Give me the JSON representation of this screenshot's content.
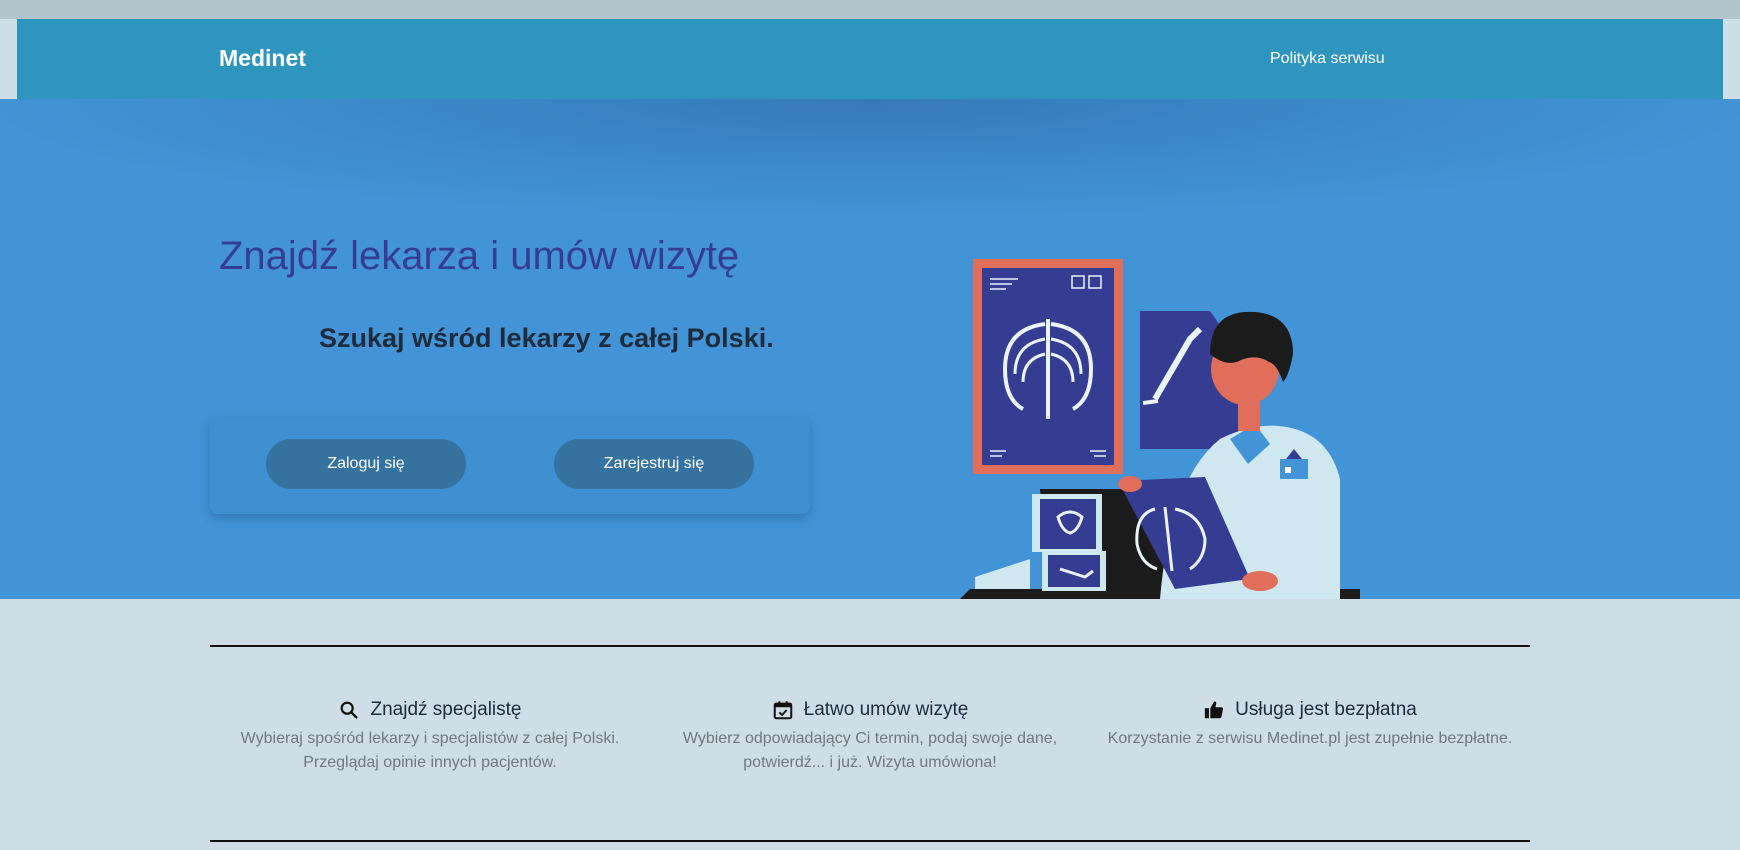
{
  "header": {
    "brand": "Medinet",
    "nav_link": "Polityka serwisu"
  },
  "hero": {
    "title": "Znajdź lekarza i umów wizytę",
    "subtitle": "Szukaj wśród lekarzy z całej Polski.",
    "login_button": "Zaloguj się",
    "register_button": "Zarejestruj się",
    "illustration_icon": "doctor-xray-illustration"
  },
  "features": [
    {
      "icon": "search-icon",
      "title": "Znajdź specjalistę",
      "desc_line1": "Wybieraj spośród lekarzy i specjalistów z całej Polski.",
      "desc_line2": "Przeglądaj opinie innych pacjentów."
    },
    {
      "icon": "calendar-check-icon",
      "title": "Łatwo umów wizytę",
      "desc_line1": "Wybierz odpowiadający Ci termin, podaj swoje dane,",
      "desc_line2": "potwierdź... i już. Wizyta umówiona!"
    },
    {
      "icon": "thumbs-up-icon",
      "title": "Usługa jest bezpłatna",
      "desc_line1": "Korzystanie z serwisu Medinet.pl jest zupełnie bezpłatne.",
      "desc_line2": ""
    }
  ],
  "colors": {
    "navbar": "#2e95bf",
    "hero": "#4294d6",
    "title": "#353d92",
    "button": "#3672a0",
    "background": "#cfdde6"
  }
}
